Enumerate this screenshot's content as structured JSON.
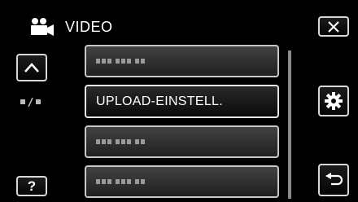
{
  "header": {
    "title": "VIDEO",
    "icon": "video-camera-icon"
  },
  "controls": {
    "close": {
      "icon": "close-icon"
    },
    "scroll_up": {
      "icon": "chevron-up-icon"
    },
    "settings": {
      "icon": "gear-icon"
    },
    "help": {
      "label": "?"
    },
    "back": {
      "icon": "return-icon"
    },
    "page_indicator": {
      "icon": "page-indicator-icon"
    }
  },
  "menu": {
    "items": [
      {
        "label": "",
        "placeholder": true
      },
      {
        "label": "UPLOAD-EINSTELL.",
        "placeholder": false,
        "selected": true
      },
      {
        "label": "",
        "placeholder": true
      },
      {
        "label": "",
        "placeholder": true
      }
    ]
  },
  "colors": {
    "background": "#000000",
    "button_border": "#d8d8d8",
    "item_fill": "#333333",
    "text": "#ffffff"
  }
}
